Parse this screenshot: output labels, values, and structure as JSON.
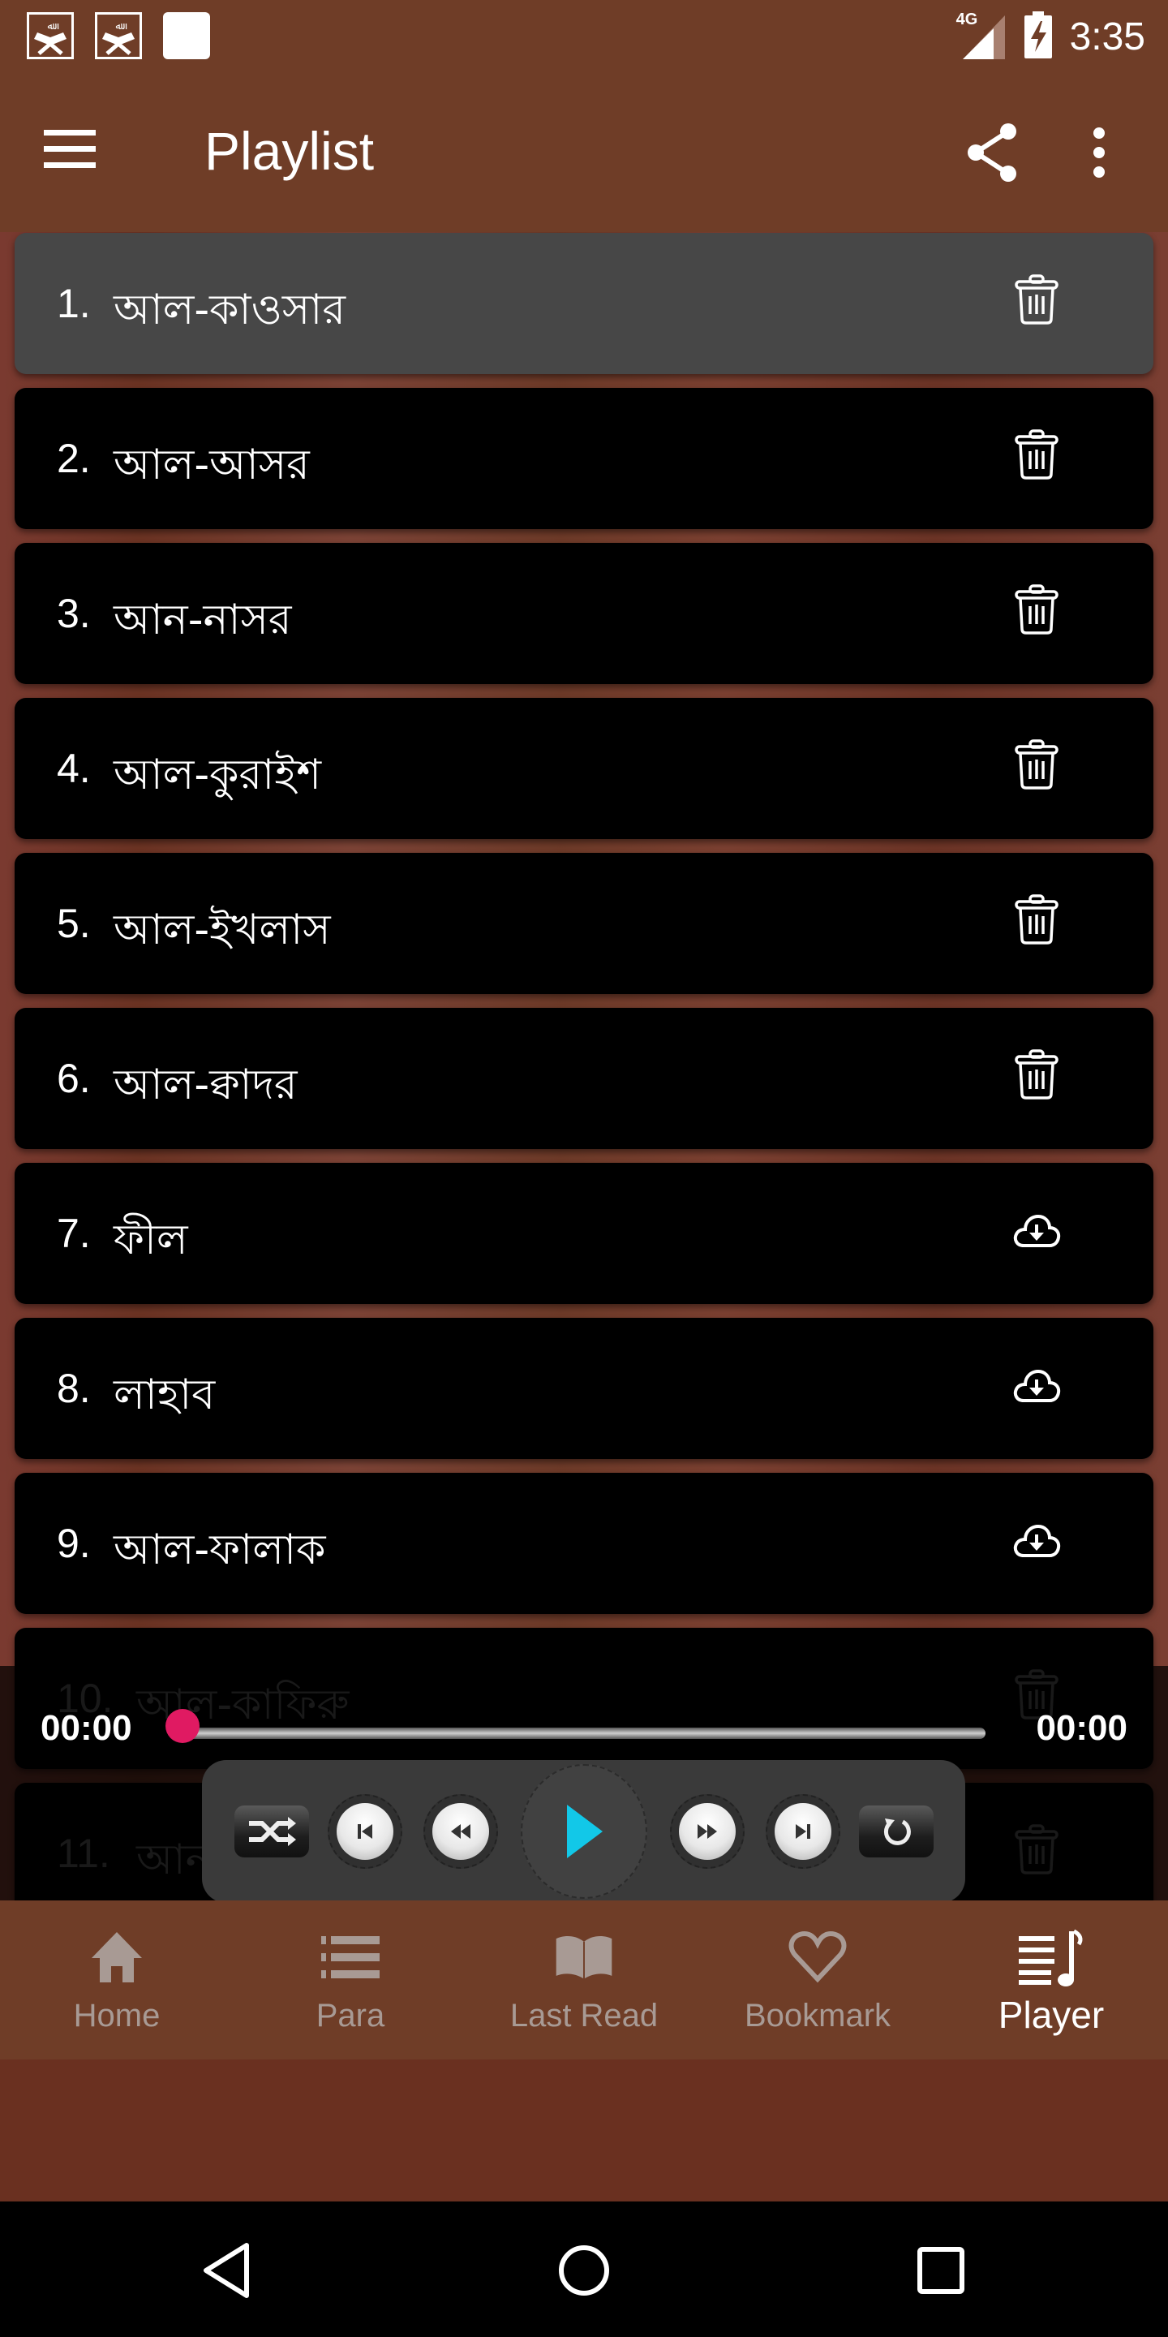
{
  "status_bar": {
    "notification_icons": [
      "quran-app-icon",
      "quran-app-icon",
      "blank-notification-icon"
    ],
    "network": "4G",
    "battery": "charging",
    "time": "3:35"
  },
  "app_bar": {
    "title": "Playlist",
    "menu_icon": "hamburger-menu-icon",
    "share_icon": "share-icon",
    "more_icon": "more-vertical-icon"
  },
  "playlist": {
    "items": [
      {
        "number": "1.",
        "title": "আল-কাওসার",
        "action": "delete",
        "active": true
      },
      {
        "number": "2.",
        "title": "আল-আসর",
        "action": "delete",
        "active": false
      },
      {
        "number": "3.",
        "title": "আন-নাসর",
        "action": "delete",
        "active": false
      },
      {
        "number": "4.",
        "title": "আল-কুরাইশ",
        "action": "delete",
        "active": false
      },
      {
        "number": "5.",
        "title": "আল-ইখলাস",
        "action": "delete",
        "active": false
      },
      {
        "number": "6.",
        "title": "আল-ক্বাদর",
        "action": "delete",
        "active": false
      },
      {
        "number": "7.",
        "title": "ফীল",
        "action": "download",
        "active": false
      },
      {
        "number": "8.",
        "title": "লাহাব",
        "action": "download",
        "active": false
      },
      {
        "number": "9.",
        "title": "আল-ফালাক",
        "action": "download",
        "active": false
      },
      {
        "number": "10.",
        "title": "আল-কাফিরু",
        "action": "delete",
        "active": false
      },
      {
        "number": "11.",
        "title": "আন-",
        "action": "delete",
        "active": false
      }
    ]
  },
  "player": {
    "current_time": "00:00",
    "total_time": "00:00",
    "progress_percent": 0,
    "accent_color": "#e01a62",
    "play_color": "#12c8e8",
    "controls": [
      "shuffle",
      "previous",
      "rewind",
      "play",
      "fast-forward",
      "next",
      "repeat"
    ]
  },
  "bottom_nav": {
    "items": [
      {
        "label": "Home",
        "icon": "home-icon",
        "active": false
      },
      {
        "label": "Para",
        "icon": "list-icon",
        "active": false
      },
      {
        "label": "Last Read",
        "icon": "open-book-icon",
        "active": false
      },
      {
        "label": "Bookmark",
        "icon": "heart-icon",
        "active": false
      },
      {
        "label": "Player",
        "icon": "music-playlist-icon",
        "active": true
      }
    ]
  },
  "colors": {
    "brand": "#6f3d27",
    "active_item_bg": "#474747",
    "item_bg": "#000000"
  }
}
